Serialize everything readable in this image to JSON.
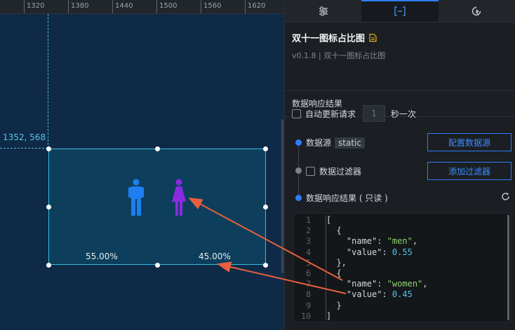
{
  "ruler": {
    "ticks": [
      "1320",
      "1380",
      "1440",
      "1500",
      "1560",
      "1620"
    ]
  },
  "canvas": {
    "coord_label": "1352, 568",
    "widget": {
      "percent_men": "55.00%",
      "percent_women": "45.00%"
    }
  },
  "colors": {
    "accent": "#2f7df6",
    "man": "#1e7ff2",
    "woman": "#8a2be2",
    "guide": "#36bde0",
    "arrow": "#e8603e"
  },
  "tabs": [
    {
      "icon": "sliders-icon"
    },
    {
      "icon": "data-bracket-icon"
    },
    {
      "icon": "interaction-icon"
    }
  ],
  "panel": {
    "title": "双十一图标占比图",
    "subtitle": "v0.1.8 | 双十一图标占比图",
    "section_title": "数据响应结果",
    "auto_update_label": "自动更新请求",
    "interval_value": "1",
    "interval_unit": "秒一次",
    "datasource_label": "数据源",
    "datasource_badge": "static",
    "config_datasource_button": "配置数据源",
    "filter_label": "数据过滤器",
    "add_filter_button": "添加过滤器",
    "result_label": "数据响应结果 ( 只读 )"
  },
  "code": {
    "line_numbers": [
      "1",
      "2",
      "3",
      "4",
      "5",
      "6",
      "7",
      "8",
      "9",
      "10"
    ],
    "data": [
      {
        "name": "men",
        "value": 0.55
      },
      {
        "name": "women",
        "value": 0.45
      }
    ]
  }
}
